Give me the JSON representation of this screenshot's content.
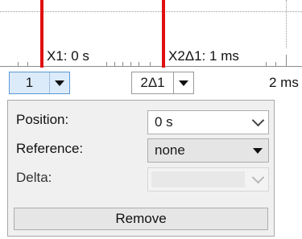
{
  "cursors": {
    "c1": {
      "label": "X1: 0 s",
      "selector_value": "1"
    },
    "c2": {
      "label": "X2Δ1: 1 ms",
      "selector_value": "2Δ1"
    }
  },
  "axis": {
    "tick_label": "2 ms"
  },
  "panel": {
    "position": {
      "label": "Position:",
      "value": "0 s"
    },
    "reference": {
      "label": "Reference:",
      "value": "none"
    },
    "delta": {
      "label": "Delta:",
      "value": ""
    },
    "remove_label": "Remove"
  },
  "colors": {
    "cursor": "#e01010",
    "accent_border": "#5c97d4",
    "active_bg": "#dcebfa"
  },
  "icons": [
    "dropdown-arrow-icon",
    "chevron-down-icon"
  ]
}
